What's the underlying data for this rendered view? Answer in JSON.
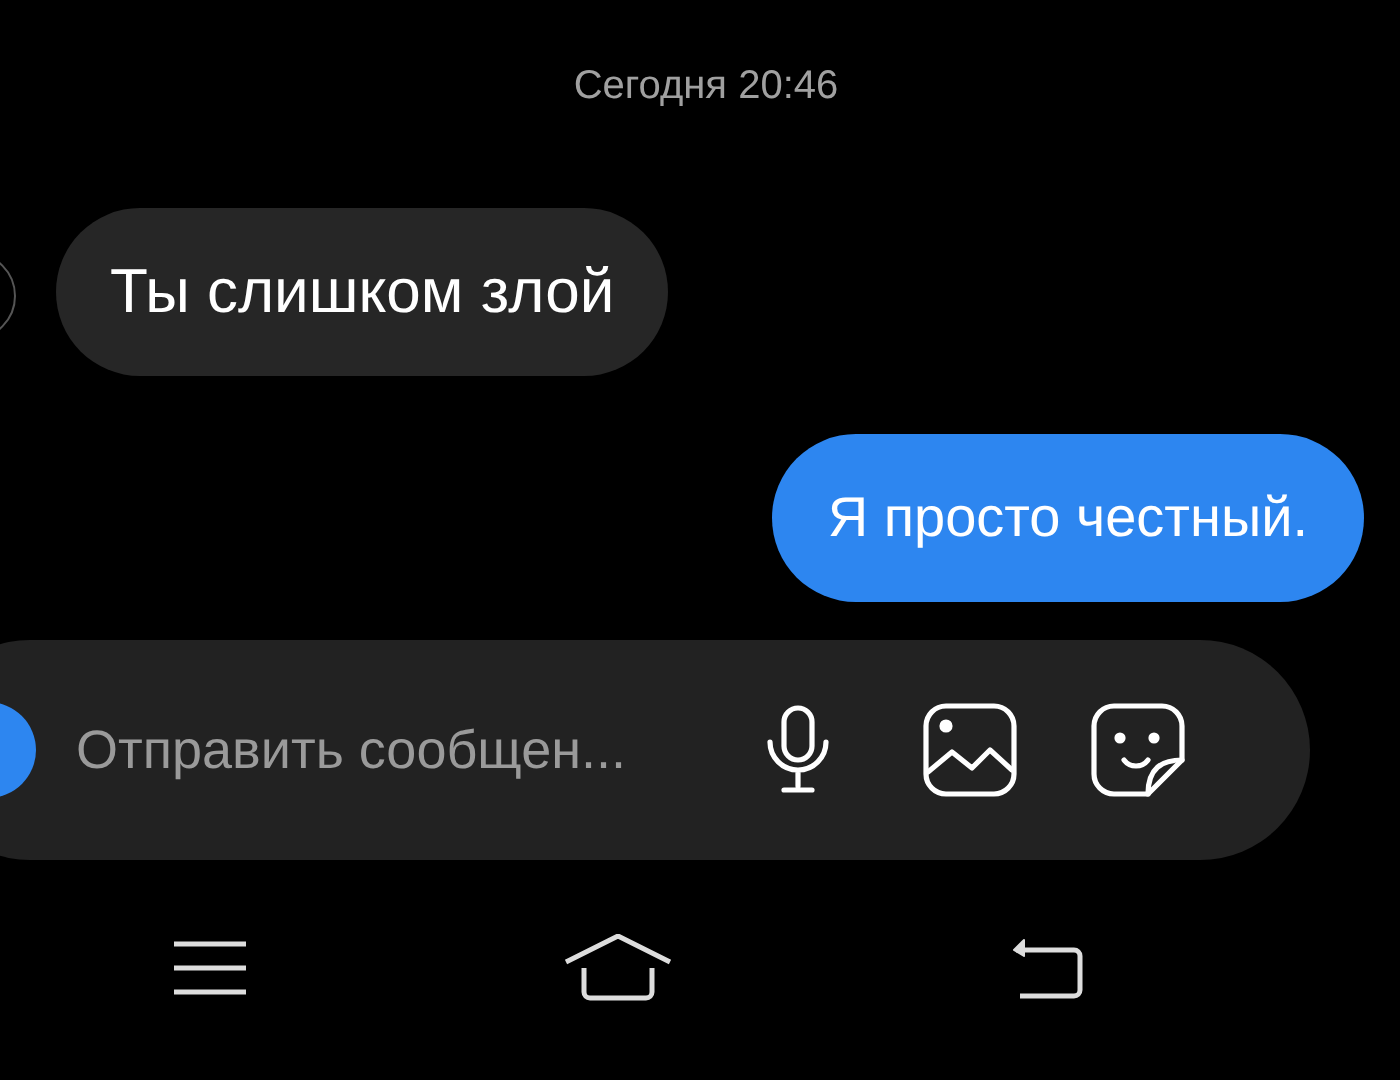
{
  "timestamp": "Сегодня 20:46",
  "messages": [
    {
      "kind": "incoming",
      "text": "Ты слишком злой"
    },
    {
      "kind": "outgoing",
      "text": "Я просто честный."
    }
  ],
  "composer": {
    "placeholder": "Отправить сообщен..."
  }
}
